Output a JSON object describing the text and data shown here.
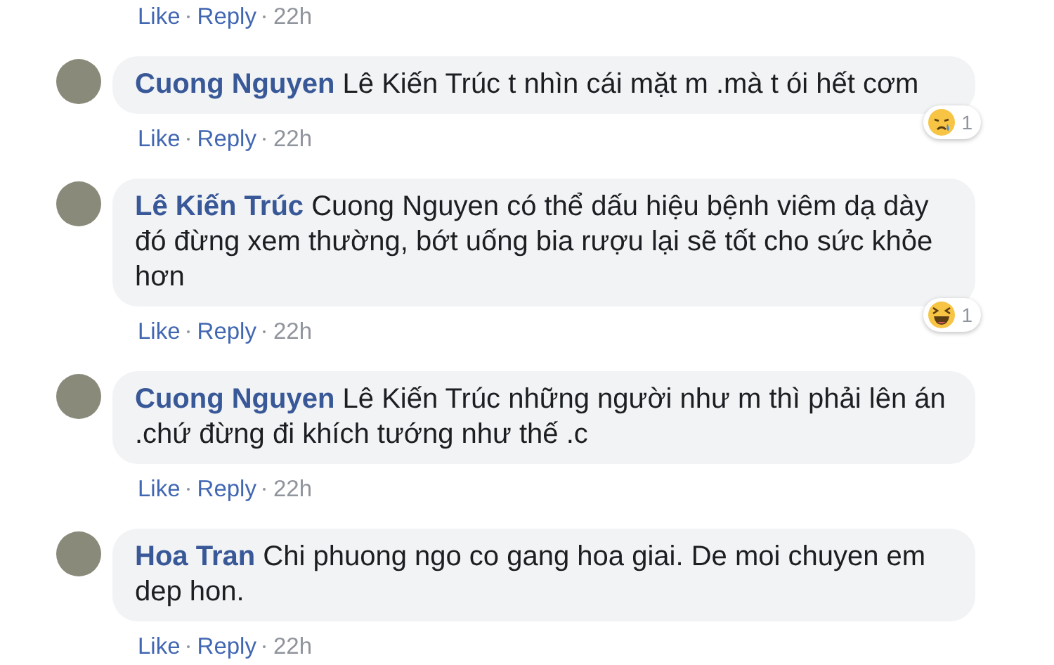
{
  "top_actions": {
    "like": "Like",
    "reply": "Reply",
    "time": "22h"
  },
  "comments": [
    {
      "author": "Cuong Nguyen",
      "text": "Lê Kiến Trúc t nhìn cái mặt m .mà t ói hết cơm",
      "reaction": {
        "kind": "sad",
        "count": "1"
      },
      "actions": {
        "like": "Like",
        "reply": "Reply",
        "time": "22h"
      }
    },
    {
      "author": "Lê Kiến Trúc",
      "text": "Cuong Nguyen có thể dấu hiệu bệnh viêm dạ dày đó đừng xem thường, bớt uống bia rượu lại sẽ tốt cho sức khỏe hơn",
      "reaction": {
        "kind": "haha",
        "count": "1"
      },
      "actions": {
        "like": "Like",
        "reply": "Reply",
        "time": "22h"
      }
    },
    {
      "author": "Cuong Nguyen",
      "text": "Lê Kiến Trúc những người như m thì phải lên án .chứ đừng đi khích tướng như thế .c",
      "actions": {
        "like": "Like",
        "reply": "Reply",
        "time": "22h"
      }
    },
    {
      "author": "Hoa Tran",
      "text": "Chi phuong ngo co gang hoa giai. De moi chuyen em dep hon.",
      "actions": {
        "like": "Like",
        "reply": "Reply",
        "time": "22h"
      }
    }
  ]
}
